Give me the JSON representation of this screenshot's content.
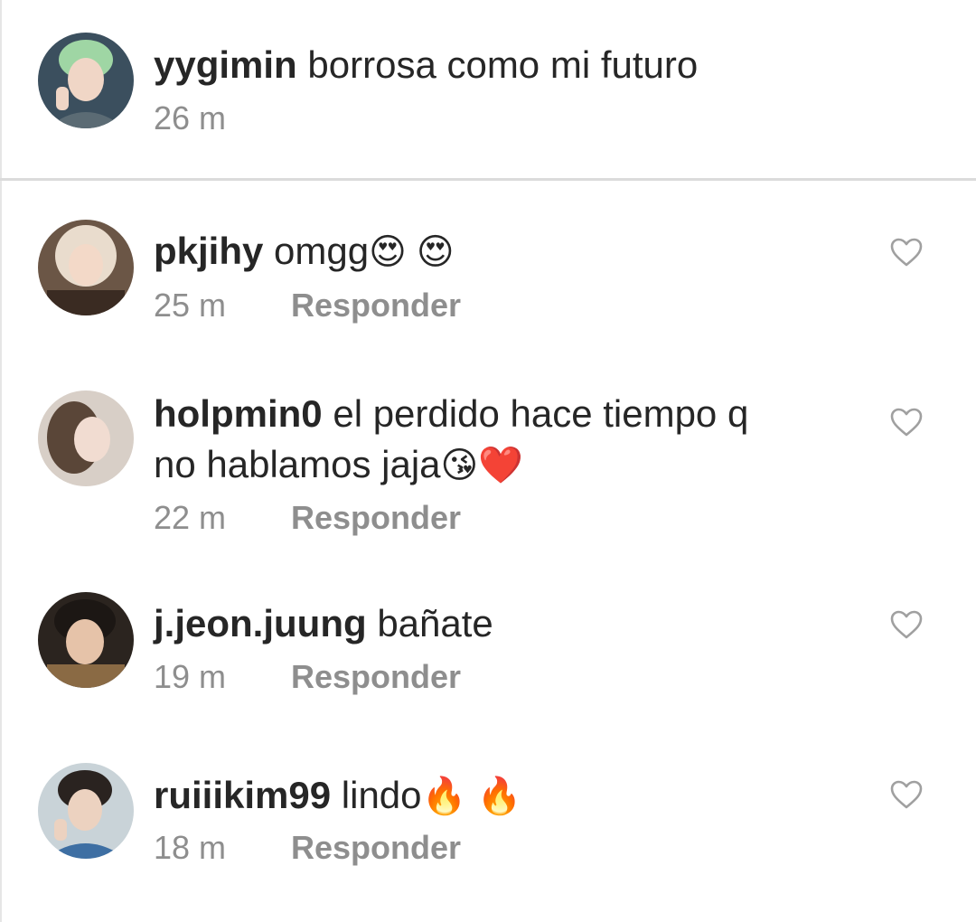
{
  "caption": {
    "username": "yygimin",
    "text": "borrosa como mi futuro",
    "time": "26 m"
  },
  "comments": [
    {
      "username": "pkjihy",
      "text": "omgg",
      "emoji": "😍 😍",
      "time": "25 m",
      "reply_label": "Responder"
    },
    {
      "username": "holpmin0",
      "text_line1": "el perdido hace tiempo q",
      "text_line2": "no hablamos jaja",
      "emoji": "😘❤️",
      "time": "22 m",
      "reply_label": "Responder"
    },
    {
      "username": "j.jeon.juung",
      "text": "bañate",
      "time": "19 m",
      "reply_label": "Responder"
    },
    {
      "username": "ruiiikim99",
      "text": "lindo",
      "emoji": "🔥 🔥",
      "time": "18 m",
      "reply_label": "Responder"
    }
  ],
  "icons": {
    "like": "heart-outline-icon"
  },
  "colors": {
    "text": "#262626",
    "secondary_text": "#8e8e8e",
    "divider": "#dbdbdb",
    "background": "#ffffff"
  }
}
